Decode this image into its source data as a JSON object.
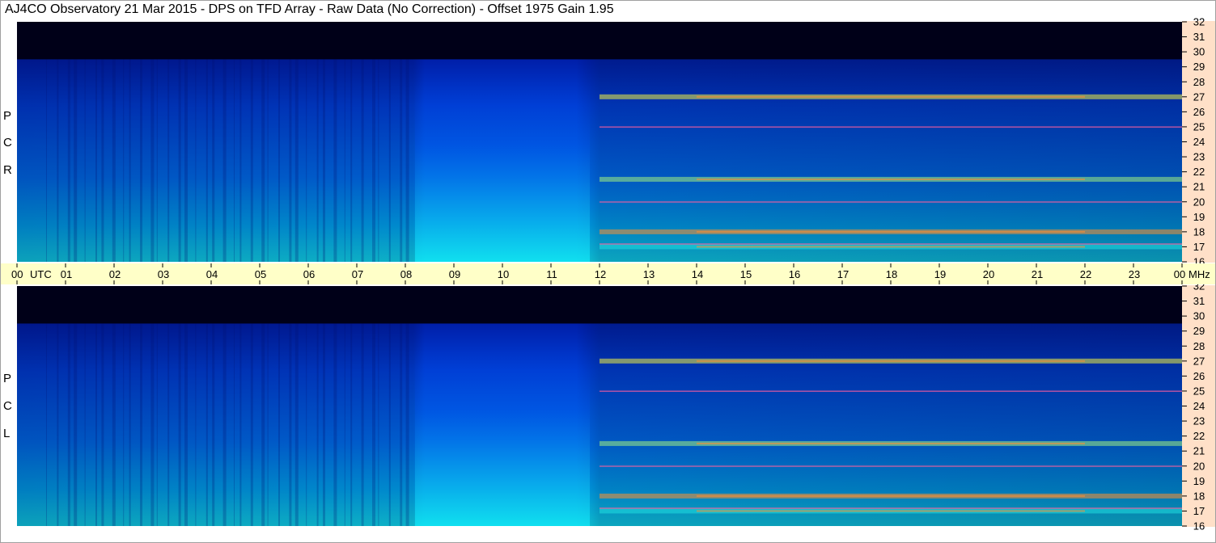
{
  "title": "AJ4CO Observatory  21 Mar 2015  -  DPS on TFD Array  -  Raw Data (No Correction)  -  Offset 1975  Gain 1.95",
  "colors": {
    "time_axis_bg": "#ffffc8",
    "freq_axis_bg": "#ffe0c8",
    "colormap": [
      "#000020",
      "#000a50",
      "#0018a0",
      "#0040d8",
      "#0078f0",
      "#00b8f0",
      "#20e0e0",
      "#a0f080",
      "#f0f040",
      "#ff9030",
      "#ff2060"
    ]
  },
  "chart_data": [
    {
      "type": "heatmap",
      "name": "R C P",
      "x_range": [
        "00",
        "00"
      ],
      "y_range": [
        16,
        32
      ],
      "y_ticks": [
        "32",
        "31",
        "30",
        "29",
        "28",
        "27",
        "26",
        "25",
        "24",
        "23",
        "22",
        "21",
        "20",
        "19",
        "18",
        "17",
        "16"
      ],
      "y_unit": "MHz",
      "dark_top_edge_mhz": 29.5,
      "bright_bands_mhz": [
        27,
        21.5,
        18,
        17
      ],
      "label_letters": [
        "P",
        "C",
        "R"
      ]
    },
    {
      "type": "heatmap",
      "name": "L C P",
      "x_range": [
        "00",
        "00"
      ],
      "y_range": [
        16,
        32
      ],
      "y_ticks": [
        "32",
        "31",
        "30",
        "29",
        "28",
        "27",
        "26",
        "25",
        "24",
        "23",
        "22",
        "21",
        "20",
        "19",
        "18",
        "17",
        "16"
      ],
      "y_unit": "MHz",
      "dark_top_edge_mhz": 29.5,
      "bright_bands_mhz": [
        27,
        21.5,
        18,
        17
      ],
      "label_letters": [
        "P",
        "C",
        "L"
      ]
    }
  ],
  "time_axis": {
    "labels": [
      "00",
      "01",
      "02",
      "03",
      "04",
      "05",
      "06",
      "07",
      "08",
      "09",
      "10",
      "11",
      "12",
      "13",
      "14",
      "15",
      "16",
      "17",
      "18",
      "19",
      "20",
      "21",
      "22",
      "23",
      "00"
    ],
    "utc_label": "UTC",
    "unit_label": "MHz"
  }
}
